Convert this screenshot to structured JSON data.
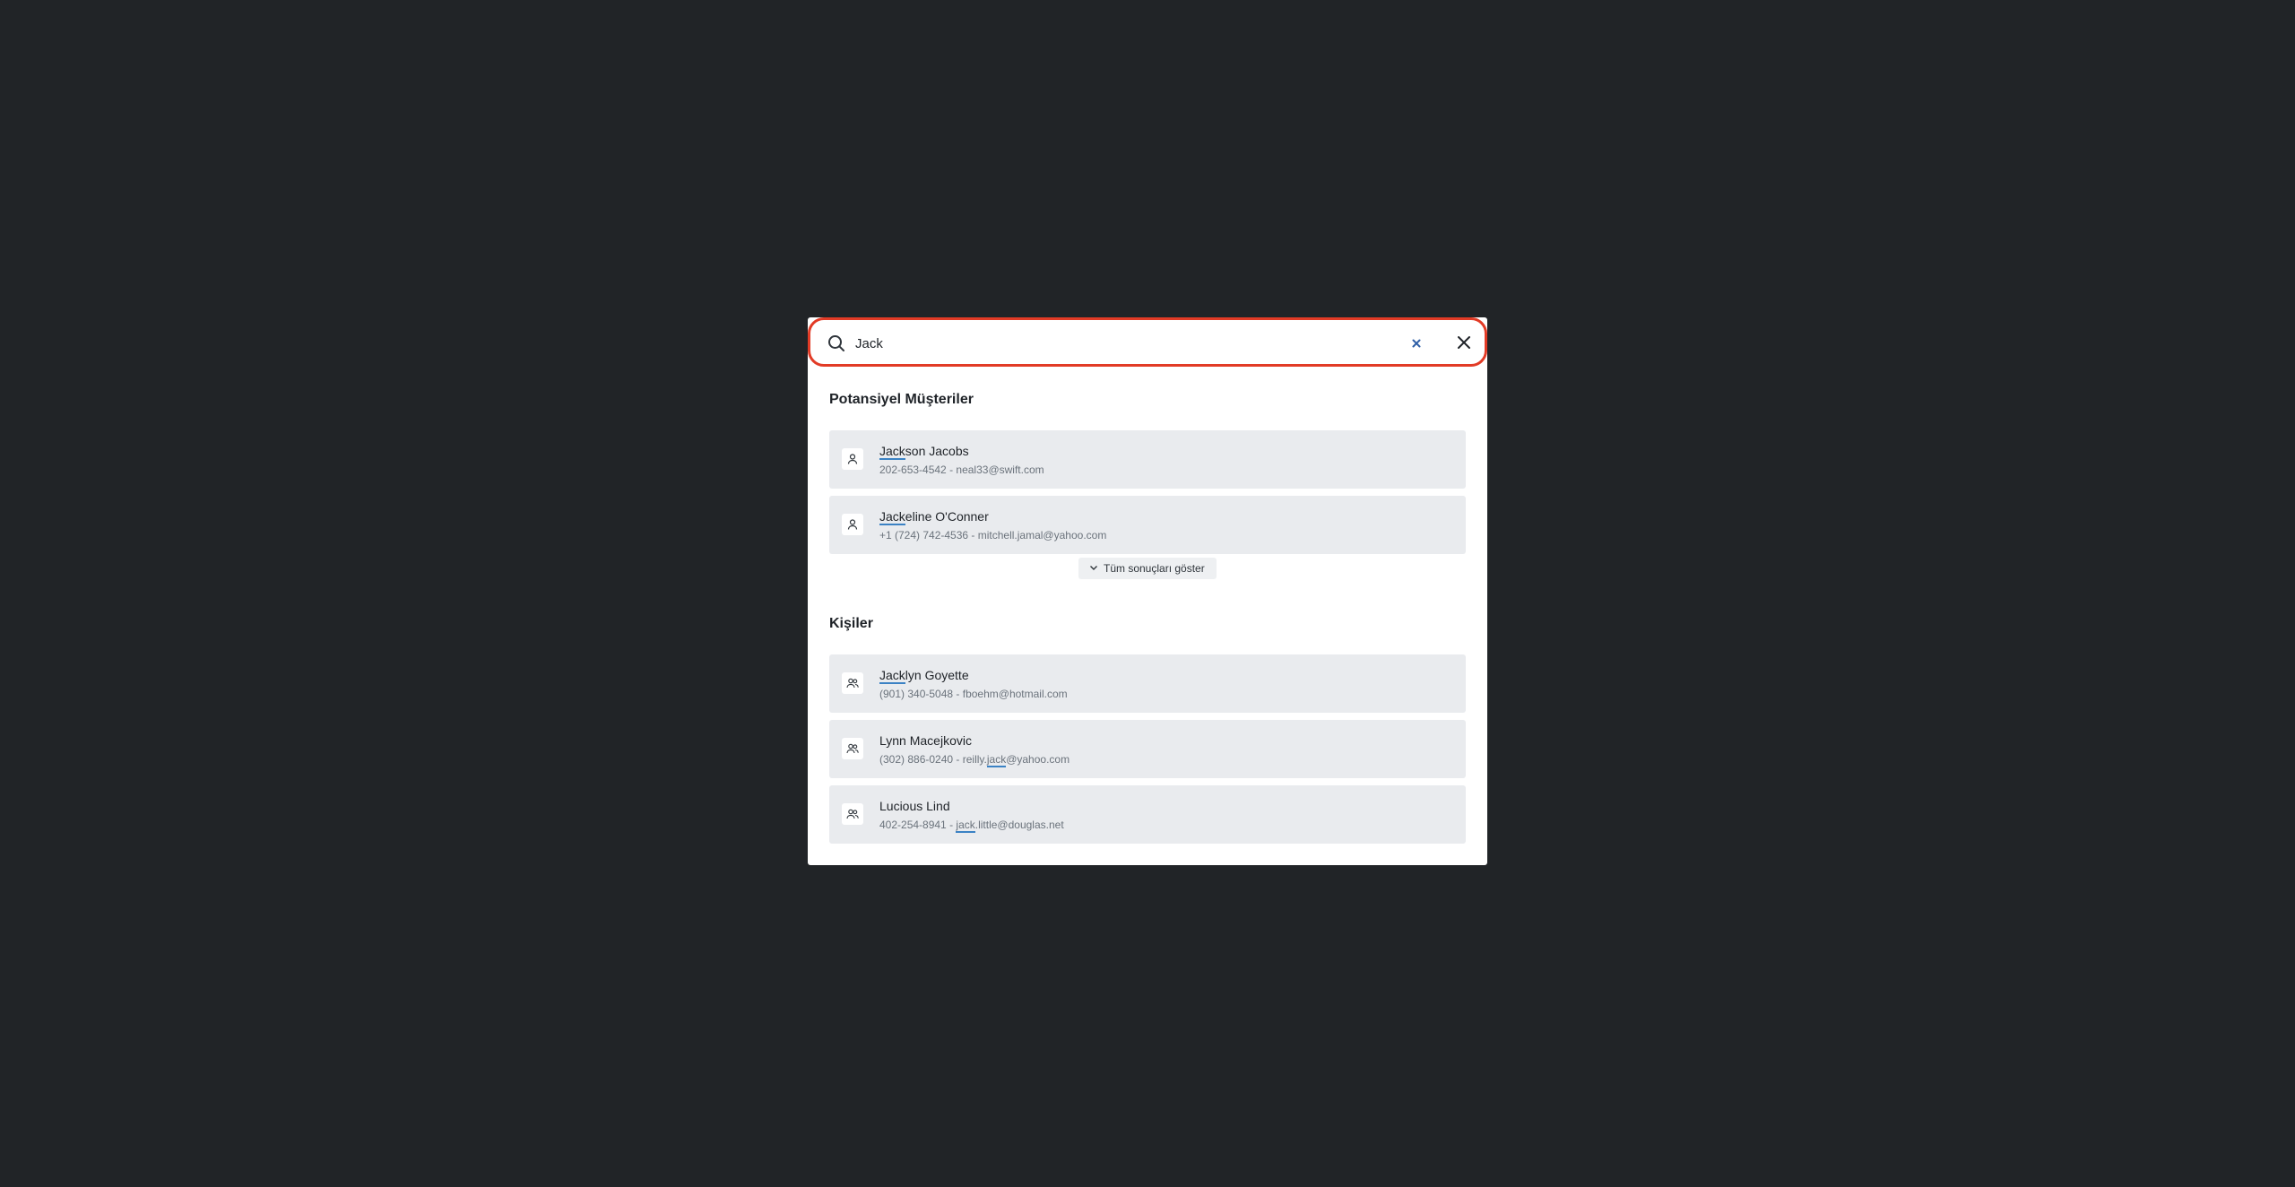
{
  "search": {
    "value": "Jack",
    "query_highlight": "Jack"
  },
  "sections": [
    {
      "title": "Potansiyel Müşteriler",
      "icon": "user-icon",
      "items": [
        {
          "name_hl": "Jack",
          "name_rest": "son Jacobs",
          "phone": "202-653-4542",
          "sep": " - ",
          "email_pre": "",
          "email_hl": "",
          "email_post": "neal33@swift.com"
        },
        {
          "name_hl": "Jack",
          "name_rest": "eline O'Conner",
          "phone": "+1 (724) 742-4536",
          "sep": " - ",
          "email_pre": "",
          "email_hl": "",
          "email_post": "mitchell.jamal@yahoo.com"
        }
      ],
      "show_all_label": "Tüm sonuçları göster"
    },
    {
      "title": "Kişiler",
      "icon": "users-icon",
      "items": [
        {
          "name_hl": "Jack",
          "name_rest": "lyn Goyette",
          "phone": "(901) 340-5048",
          "sep": " - ",
          "email_pre": "",
          "email_hl": "",
          "email_post": "fboehm@hotmail.com"
        },
        {
          "name_hl": "",
          "name_rest": "Lynn Macejkovic",
          "phone": "(302) 886-0240",
          "sep": " - ",
          "email_pre": "reilly.",
          "email_hl": "jack",
          "email_post": "@yahoo.com"
        },
        {
          "name_hl": "",
          "name_rest": "Lucious Lind",
          "phone": "402-254-8941",
          "sep": " - ",
          "email_pre": "",
          "email_hl": "jack",
          "email_post": ".little@douglas.net"
        }
      ]
    }
  ],
  "colors": {
    "backdrop": "#212427",
    "focus_ring": "#e23b26",
    "row_bg": "#e9ebee",
    "highlight_underline": "#3b82c4",
    "clear_icon": "#2f5fa7"
  }
}
